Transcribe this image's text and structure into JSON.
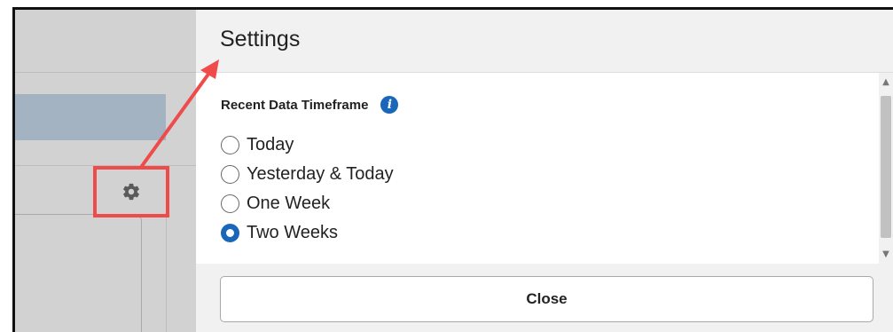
{
  "modal": {
    "title": "Settings",
    "field_label": "Recent Data Timeframe",
    "info_icon": "info-icon",
    "options": [
      {
        "label": "Today",
        "checked": false
      },
      {
        "label": "Yesterday & Today",
        "checked": false
      },
      {
        "label": "One Week",
        "checked": false
      },
      {
        "label": "Two Weeks",
        "checked": true
      }
    ],
    "close_label": "Close"
  },
  "background": {
    "settings_icon": "gear-icon"
  },
  "colors": {
    "accent": "#1a66b9",
    "highlight": "#ef4b4b",
    "modal_bg": "#f1f1f1",
    "backdrop": "#d2d2d2"
  }
}
